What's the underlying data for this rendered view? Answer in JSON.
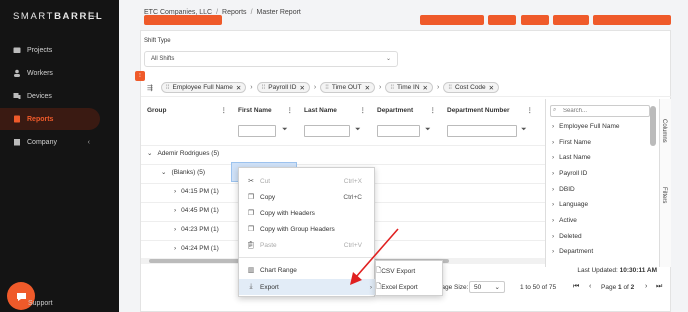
{
  "sidebar": {
    "logo_light": "SMART",
    "logo_bold": "BARREL",
    "items": [
      {
        "label": "Projects",
        "icon": "folder-icon"
      },
      {
        "label": "Workers",
        "icon": "person-icon"
      },
      {
        "label": "Devices",
        "icon": "devices-icon"
      },
      {
        "label": "Reports",
        "icon": "document-icon"
      },
      {
        "label": "Company",
        "icon": "building-icon"
      }
    ],
    "support_label": "Support"
  },
  "breadcrumb": {
    "items": [
      "ETC Companies, LLC",
      "Reports",
      "Master Report"
    ],
    "separator": "/"
  },
  "shift": {
    "label": "Shift Type",
    "value": "All Shifts"
  },
  "grouping": {
    "icon": "group-icon",
    "chips": [
      "Employee Full Name",
      "Payroll ID",
      "Time OUT",
      "Time IN",
      "Cost Code"
    ]
  },
  "grid": {
    "headers": [
      "Group",
      "First Name",
      "Last Name",
      "Department",
      "Department Number"
    ],
    "rows": [
      {
        "label": "Ademir Rodrigues (5)"
      },
      {
        "label": "(Blanks) (5)"
      },
      {
        "label": "04:15 PM (1)"
      },
      {
        "label": "04:45 PM (1)"
      },
      {
        "label": "04:23 PM (1)"
      },
      {
        "label": "04:24 PM (1)"
      }
    ]
  },
  "columns_panel": {
    "search_placeholder": "Search...",
    "items": [
      "Employee Full Name",
      "First Name",
      "Last Name",
      "Payroll ID",
      "DBID",
      "Language",
      "Active",
      "Deleted",
      "Department"
    ],
    "tab_columns": "Columns",
    "tab_filters": "Filters"
  },
  "context_menu": {
    "items": [
      {
        "label": "Cut",
        "shortcut": "Ctrl+X",
        "icon": "scissors-icon"
      },
      {
        "label": "Copy",
        "shortcut": "Ctrl+C",
        "icon": "copy-icon"
      },
      {
        "label": "Copy with Headers",
        "shortcut": "",
        "icon": "copy-icon"
      },
      {
        "label": "Copy with Group Headers",
        "shortcut": "",
        "icon": "copy-icon"
      },
      {
        "label": "Paste",
        "shortcut": "Ctrl+V",
        "icon": "paste-icon"
      },
      {
        "label": "Chart Range",
        "shortcut": "",
        "icon": "chart-icon"
      },
      {
        "label": "Export",
        "shortcut": "",
        "icon": "download-icon"
      }
    ],
    "submenu": [
      "CSV Export",
      "Excel Export"
    ]
  },
  "footer": {
    "last_updated_label": "Last Updated:",
    "last_updated_value": "10:30:11 AM",
    "page_size_label": "Page Size:",
    "page_size_value": "50",
    "range_text": "1 to 50 of 75",
    "page_text_prefix": "Page",
    "page_current": "1",
    "page_text_of": "of",
    "page_total": "2"
  },
  "colors": {
    "accent": "#ef5a2a",
    "sidebar_bg": "#141414",
    "arrow": "#e02020"
  }
}
